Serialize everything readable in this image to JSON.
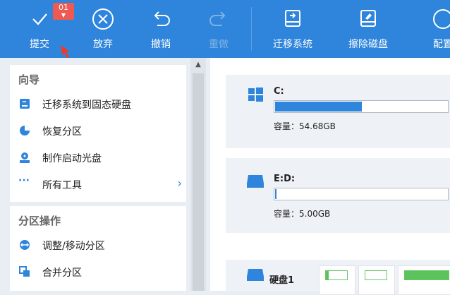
{
  "toolbar": {
    "badge": "01",
    "buttons": [
      {
        "label": "提交",
        "icon": "check-icon"
      },
      {
        "label": "放弃",
        "icon": "x-circle-icon"
      },
      {
        "label": "撤销",
        "icon": "undo-icon"
      },
      {
        "label": "重做",
        "icon": "redo-icon",
        "disabled": true
      },
      {
        "label": "迁移系统",
        "icon": "migrate-disk-icon"
      },
      {
        "label": "擦除磁盘",
        "icon": "wipe-disk-icon"
      },
      {
        "label": "配置",
        "icon": "settings-icon"
      }
    ]
  },
  "sidebar": {
    "sections": [
      {
        "title": "向导",
        "items": [
          {
            "label": "迁移系统到固态硬盘",
            "icon": "migrate-ssd-icon"
          },
          {
            "label": "恢复分区",
            "icon": "restore-partition-icon"
          },
          {
            "label": "制作启动光盘",
            "icon": "bootable-disc-icon"
          },
          {
            "label": "所有工具",
            "icon": "more-icon",
            "chevron": "›"
          }
        ]
      },
      {
        "title": "分区操作",
        "items": [
          {
            "label": "调整/移动分区",
            "icon": "resize-partition-icon"
          },
          {
            "label": "合并分区",
            "icon": "merge-partition-icon"
          }
        ]
      }
    ]
  },
  "main": {
    "drives": [
      {
        "name": "C:",
        "capacity": "容量：54.68GB",
        "fill_fraction": 0.5,
        "icon": "windows-icon"
      },
      {
        "name": "E:D:",
        "capacity": "容量：5.00GB",
        "fill_fraction": 0.01,
        "icon": "drive-icon"
      }
    ],
    "disk": {
      "label": "硬盘1",
      "icon": "hard-disk-icon"
    }
  },
  "colors": {
    "toolbar_bg": "#2e85db",
    "badge_bg": "#ee5a52",
    "accent": "#2e85db",
    "partition_green": "#5cc35c"
  }
}
